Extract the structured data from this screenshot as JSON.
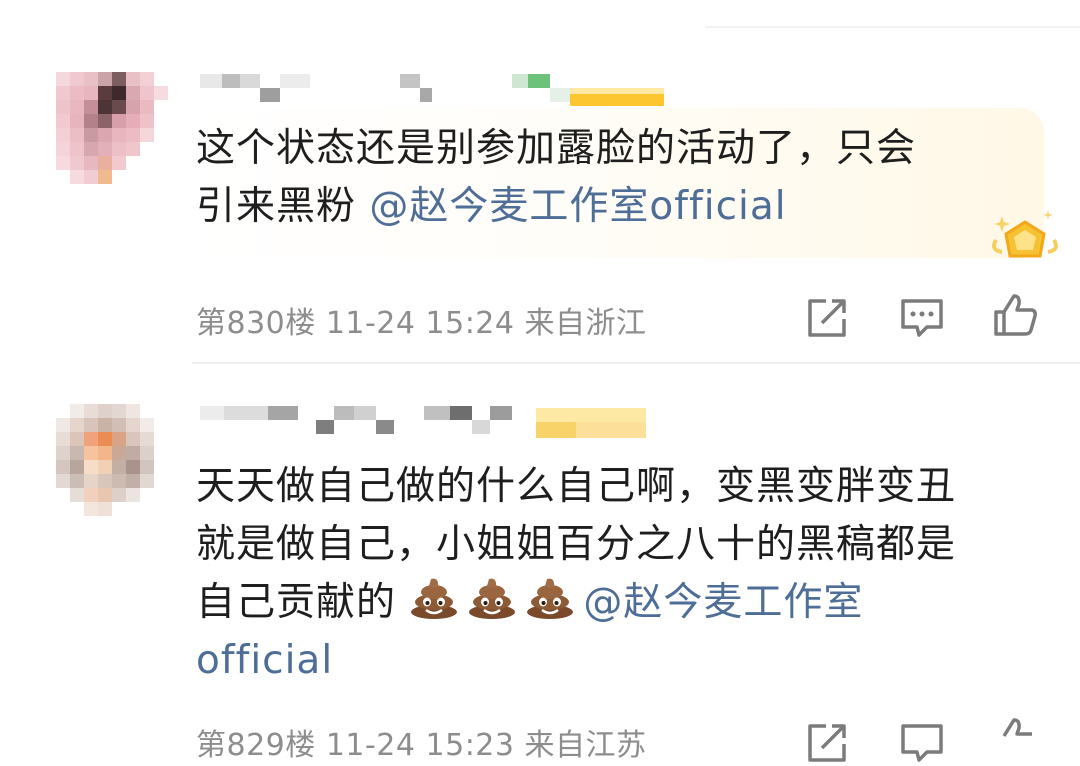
{
  "comments": [
    {
      "text_line1": "这个状态还是别参加露脸的活动了，只会",
      "text_line2_prefix": "引来黑粉 ",
      "mention": "@赵今麦工作室official",
      "floor": "第830楼",
      "datetime": "11-24 15:24",
      "location": "来自浙江"
    },
    {
      "text_line1": "天天做自己做的什么自己啊，变黑变胖变丑",
      "text_line2": "就是做自己，小姐姐百分之八十的黑稿都是",
      "text_line3_prefix": "自己贡献的",
      "emoji": "poop-emoji",
      "mention_part1": "@赵今麦工作室",
      "mention_part2": "official",
      "floor": "第829楼",
      "datetime": "11-24 15:23",
      "location": "来自江苏"
    }
  ],
  "colors": {
    "mention": "#4e6e98",
    "meta": "#8d8d8d",
    "text": "#1e1e1e"
  },
  "icons": [
    "share-icon",
    "reply-icon",
    "like-icon",
    "vip-crown-icon"
  ]
}
